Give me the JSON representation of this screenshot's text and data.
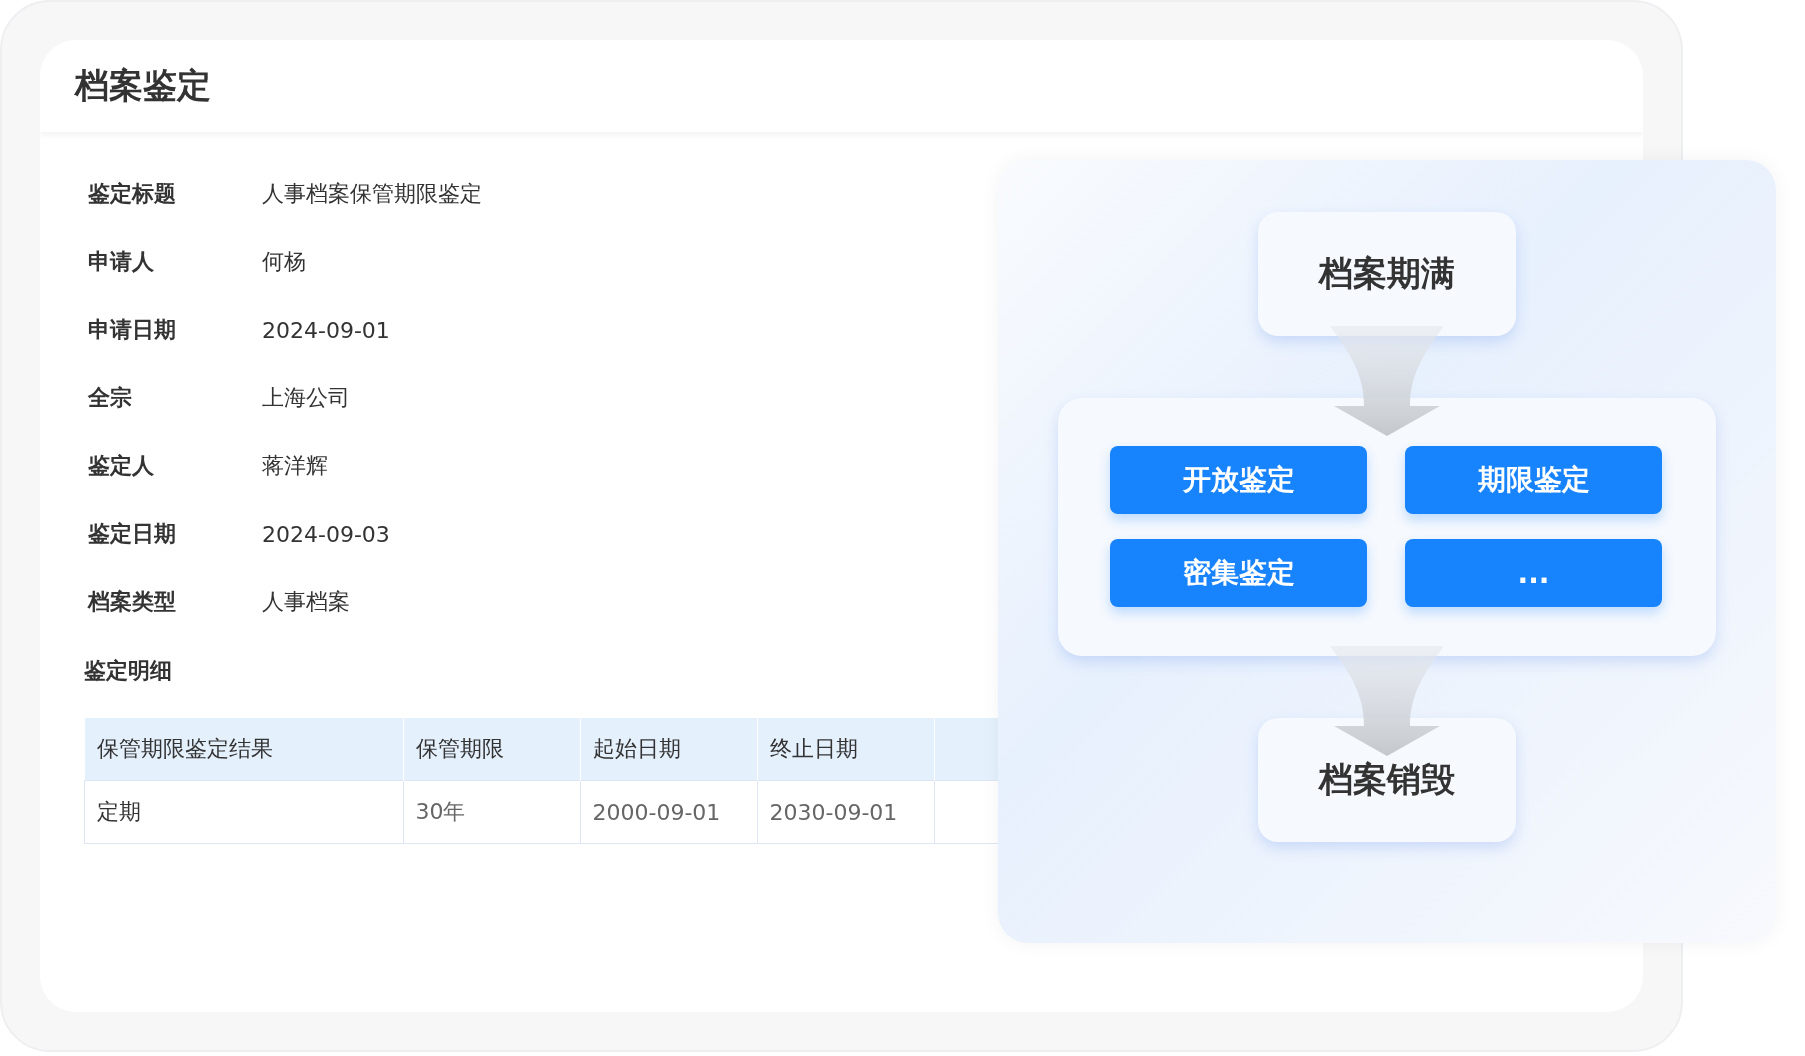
{
  "page": {
    "title": "档案鉴定"
  },
  "fields": [
    {
      "label": "鉴定标题",
      "value": "人事档案保管期限鉴定"
    },
    {
      "label": "申请人",
      "value": "何杨"
    },
    {
      "label": "申请日期",
      "value": "2024-09-01"
    },
    {
      "label": "全宗",
      "value": "上海公司"
    },
    {
      "label": "鉴定人",
      "value": "蒋洋辉"
    },
    {
      "label": "鉴定日期",
      "value": "2024-09-03"
    },
    {
      "label": "档案类型",
      "value": "人事档案"
    }
  ],
  "details": {
    "title": "鉴定明细",
    "columns": [
      "保管期限鉴定结果",
      "保管期限",
      "起始日期",
      "终止日期"
    ],
    "rows": [
      [
        "定期",
        "30年",
        "2000-09-01",
        "2030-09-01"
      ]
    ]
  },
  "flow": {
    "start": "档案期满",
    "methods": [
      "开放鉴定",
      "期限鉴定",
      "密集鉴定",
      "..."
    ],
    "end": "档案销毁"
  }
}
